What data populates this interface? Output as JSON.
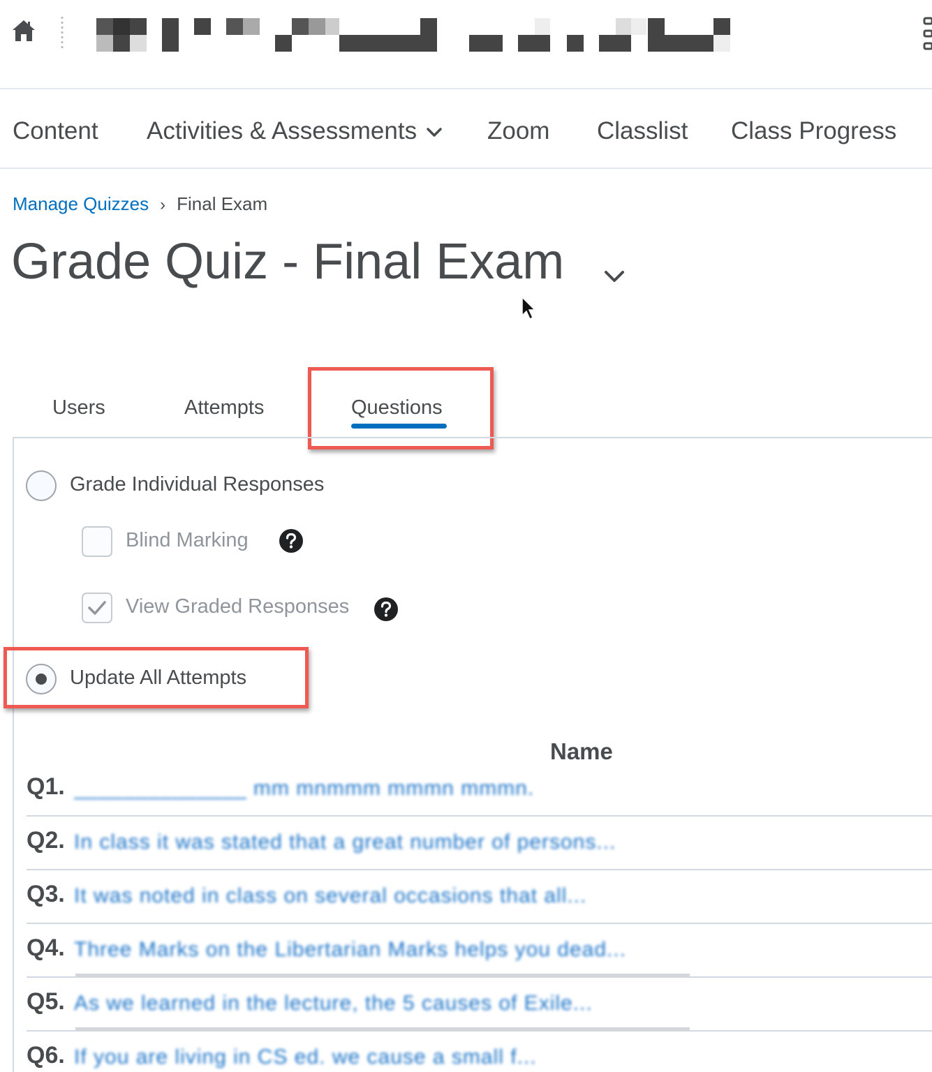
{
  "header": {
    "home_icon": "home-icon",
    "org_name": "",
    "apps_icon": "grid-icon"
  },
  "nav": {
    "items": [
      {
        "label": "Content"
      },
      {
        "label": "Activities & Assessments",
        "icon": "chevron-down-icon"
      },
      {
        "label": "Zoom"
      },
      {
        "label": "Classlist"
      },
      {
        "label": "Class Progress"
      }
    ]
  },
  "breadcrumb": {
    "link": "Manage Quizzes",
    "separator": "›",
    "current": "Final Exam"
  },
  "page": {
    "title": "Grade Quiz - Final Exam",
    "title_menu_icon": "chevron-down-icon"
  },
  "tabs": [
    {
      "label": "Users",
      "selected": false
    },
    {
      "label": "Attempts",
      "selected": false
    },
    {
      "label": "Questions",
      "selected": true
    }
  ],
  "options": {
    "grade_individual": {
      "label": "Grade Individual Responses",
      "selected": false
    },
    "blind_marking": {
      "label": "Blind Marking",
      "checked": false,
      "disabled": true
    },
    "view_graded": {
      "label": "View Graded Responses",
      "checked": true,
      "disabled": true
    },
    "update_all": {
      "label": "Update All Attempts",
      "selected": true
    }
  },
  "table": {
    "column_header": "Name",
    "rows": [
      {
        "num": "Q1.",
        "name": "______________ mm mnmmm mmmn mmmn."
      },
      {
        "num": "Q2.",
        "name": "In class it was stated that a great number of persons..."
      },
      {
        "num": "Q3.",
        "name": "It was noted in class on several occasions that all..."
      },
      {
        "num": "Q4.",
        "name": "Three Marks on the Libertarian Marks helps you dead..."
      },
      {
        "num": "Q5.",
        "name": "As we learned in the lecture, the 5 causes of Exile..."
      },
      {
        "num": "Q6.",
        "name": "If you are living in CS ed. we cause a small f..."
      }
    ]
  },
  "colors": {
    "accent": "#006fbf",
    "highlight": "#ee5a52",
    "text": "#494c4e",
    "link_blurred": "#1a73c8"
  }
}
